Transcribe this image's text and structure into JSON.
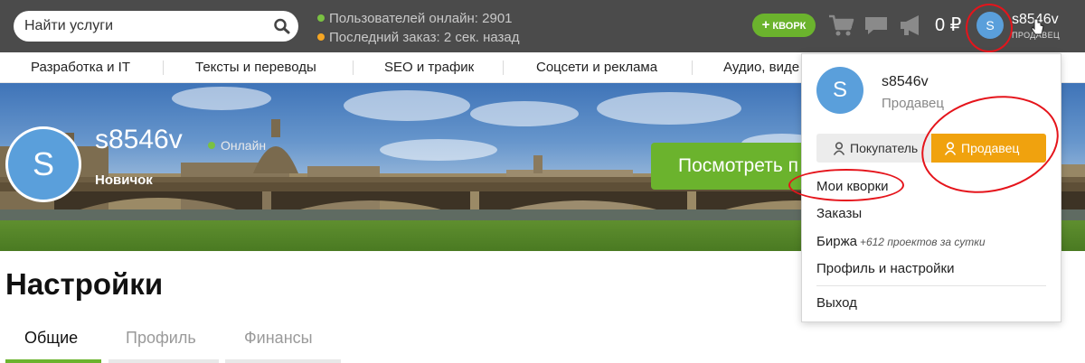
{
  "header": {
    "search": {
      "placeholder": "Найти услуги"
    },
    "stats": {
      "online": "Пользователей онлайн: 2901",
      "last_order": "Последний заказ: 2 сек. назад",
      "online_dot_color": "#7ac142",
      "order_dot_color": "#f5a623"
    },
    "add_kwork_label": "КВОРК",
    "balance": "0 ₽",
    "avatar_letter": "S",
    "username": "s8546v",
    "role": "ПРОДАВЕЦ",
    "icons": [
      "cart-icon",
      "chat-icon",
      "megaphone-icon"
    ]
  },
  "categories": [
    "Разработка и IT",
    "Тексты и переводы",
    "SEO и трафик",
    "Соцсети и реклама",
    "Аудио, виде"
  ],
  "profile": {
    "avatar_letter": "S",
    "username": "s8546v",
    "status": "Онлайн",
    "level": "Новичок",
    "view_button": "Посмотреть п"
  },
  "settings": {
    "title": "Настройки",
    "tabs": [
      {
        "label": "Общие",
        "active": true
      },
      {
        "label": "Профиль",
        "active": false
      },
      {
        "label": "Финансы",
        "active": false
      }
    ]
  },
  "dropdown": {
    "avatar_letter": "S",
    "username": "s8546v",
    "role": "Продавец",
    "buyer_label": "Покупатель",
    "seller_label": "Продавец",
    "items": {
      "my_kworks": "Мои кворки",
      "orders": "Заказы",
      "exchange": "Биржа",
      "exchange_note": "+612 проектов за сутки",
      "profile_settings": "Профиль и настройки",
      "logout": "Выход"
    }
  },
  "colors": {
    "accent_green": "#6bb32d",
    "seller_orange": "#f0a20e",
    "avatar_blue": "#5a9fdb",
    "annotation_red": "#e5141b"
  }
}
